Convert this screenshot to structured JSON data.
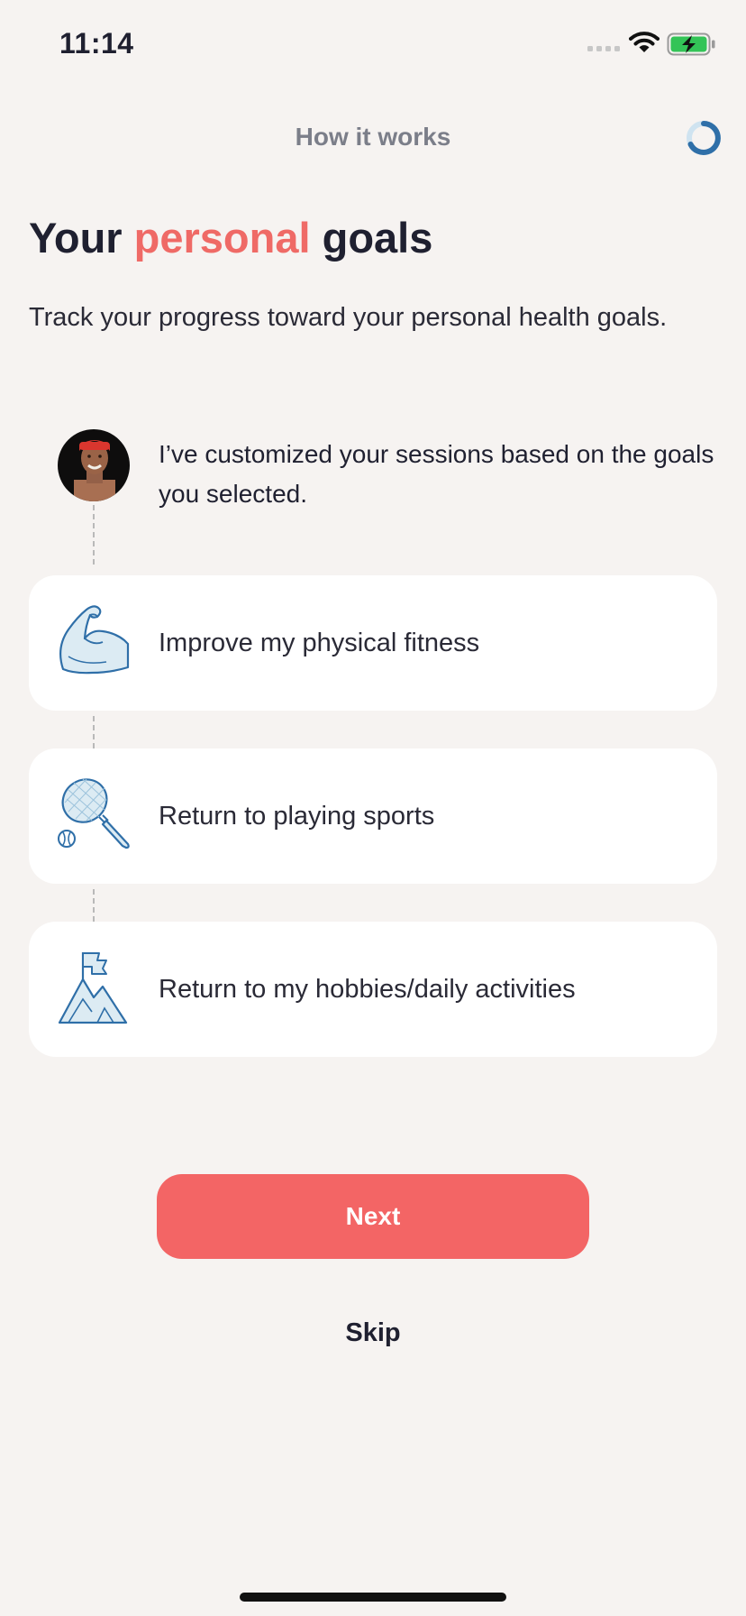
{
  "status_bar": {
    "time": "11:14",
    "icons": [
      "cellular-signal-icon",
      "wifi-icon",
      "battery-charging-icon"
    ]
  },
  "header": {
    "title": "How it works",
    "progress_icon": "progress-ring-icon"
  },
  "page": {
    "title_prefix": "Your ",
    "title_accent": "personal",
    "title_suffix": " goals",
    "subtitle": "Track your progress toward your personal health goals."
  },
  "coach": {
    "message": "I’ve customized your sessions based on the goals you selected."
  },
  "goals": [
    {
      "label": "Improve my physical fitness",
      "icon": "flexed-arm-icon"
    },
    {
      "label": "Return to playing sports",
      "icon": "tennis-racket-icon"
    },
    {
      "label": "Return to my hobbies/daily activities",
      "icon": "mountain-flag-icon"
    }
  ],
  "actions": {
    "next_label": "Next",
    "skip_label": "Skip"
  },
  "colors": {
    "background": "#f6f3f1",
    "accent": "#ef6a66",
    "button": "#f36565",
    "icon_blue": "#2f6fa8",
    "icon_fill": "#dcebf3"
  }
}
